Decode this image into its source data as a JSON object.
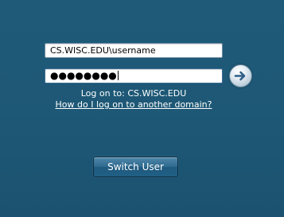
{
  "login": {
    "username_value": "CS.WISC.EDU\\username",
    "password_mask": "●●●●●●●●",
    "logon_text": "Log on to: CS.WISC.EDU",
    "other_domain_link": "How do I log on to another domain?",
    "switch_user_label": "Switch User",
    "go_icon": "right-arrow-icon"
  },
  "colors": {
    "background": "#1f5a78",
    "button_bg": "#2f6a8f",
    "text": "#ffffff"
  }
}
